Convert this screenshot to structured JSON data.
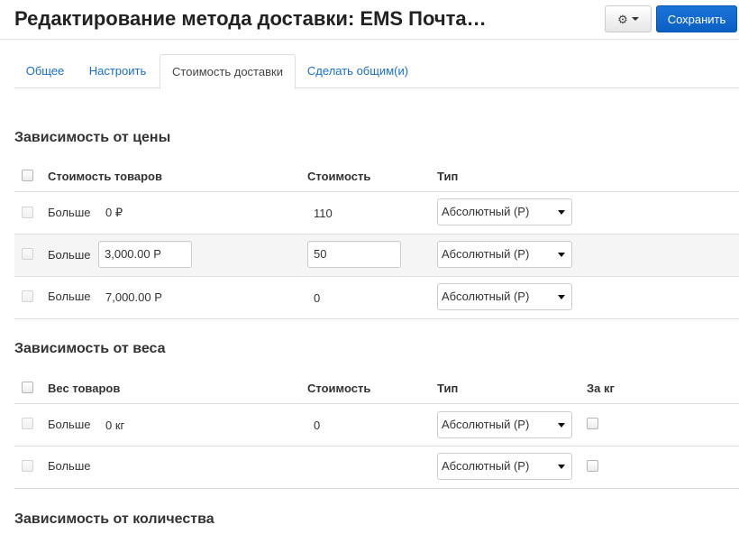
{
  "header": {
    "title": "Редактирование метода доставки: EMS Почта…",
    "settings_icon": "gear-icon",
    "save_label": "Сохранить"
  },
  "tabs": [
    {
      "label": "Общее",
      "active": false
    },
    {
      "label": "Настроить",
      "active": false
    },
    {
      "label": "Стоимость доставки",
      "active": true
    },
    {
      "label": "Сделать общим(и)",
      "active": false
    }
  ],
  "price_section": {
    "title": "Зависимость от цены",
    "headers": {
      "goods_cost": "Стоимость товаров",
      "cost": "Стоимость",
      "type": "Тип"
    },
    "rows": [
      {
        "label": "Больше",
        "threshold": "0 ₽",
        "cost": "110",
        "type": "Абсолютный (Р)"
      },
      {
        "label": "Больше",
        "threshold": "3,000.00 Р",
        "cost": "50",
        "type": "Абсолютный (Р)"
      },
      {
        "label": "Больше",
        "threshold": "7,000.00 Р",
        "cost": "0",
        "type": "Абсолютный (Р)"
      }
    ]
  },
  "weight_section": {
    "title": "Зависимость от веса",
    "headers": {
      "goods_weight": "Вес товаров",
      "cost": "Стоимость",
      "type": "Тип",
      "per_kg": "За кг"
    },
    "rows": [
      {
        "label": "Больше",
        "threshold": "0 кг",
        "cost": "0",
        "type": "Абсолютный (Р)"
      },
      {
        "label": "Больше",
        "threshold": "",
        "cost": "",
        "type": "Абсолютный (Р)"
      }
    ]
  },
  "quantity_section": {
    "title": "Зависимость от количества"
  }
}
